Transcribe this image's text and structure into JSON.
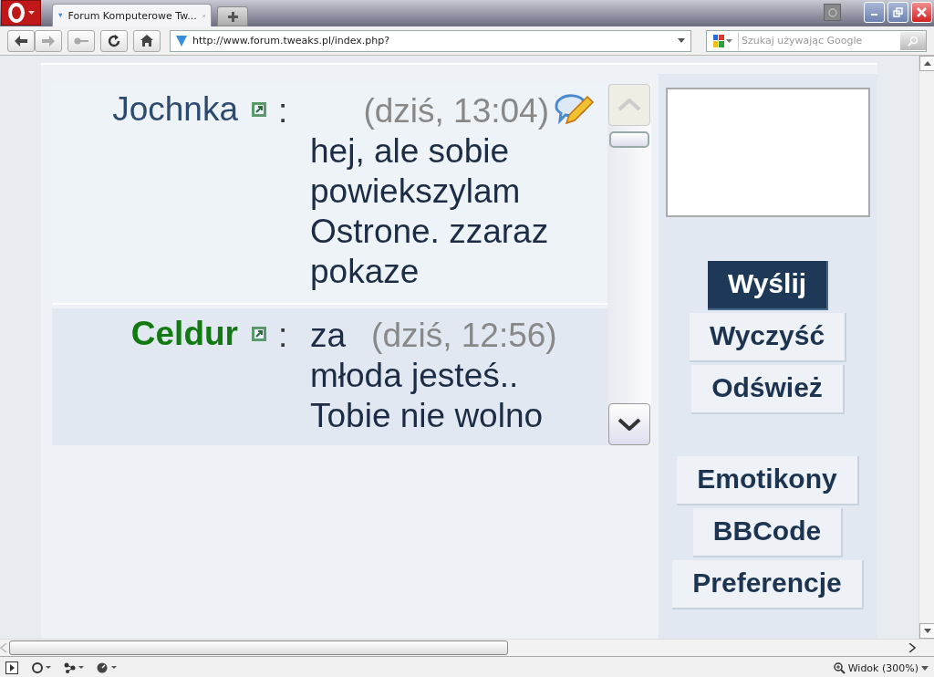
{
  "browser": {
    "tabs": [
      {
        "title": "Forum Komputerowe Tw...",
        "selected": true
      }
    ],
    "address": "http://www.forum.tweaks.pl/index.php?",
    "search": {
      "placeholder": "Szukaj używając Google"
    },
    "zoom": "Widok (300%)"
  },
  "chat": {
    "messages": [
      {
        "author": "Jochnka",
        "kind": "user",
        "color": "#2c4a6e",
        "separator": ":",
        "time": "(dziś, 13:04)",
        "editable": true,
        "text": "hej, ale sobie powiekszylam Ostrone. zzaraz pokaze"
      },
      {
        "author": "Celdur",
        "kind": "moderator",
        "color": "#137a13",
        "separator": ":",
        "lead": "za",
        "time": "(dziś, 12:56)",
        "editable": false,
        "text": "młoda jesteś.. Tobie nie wolno"
      }
    ]
  },
  "sidebar": {
    "send_buttons": [
      "Wyślij",
      "Wyczyść",
      "Odśwież"
    ],
    "tool_buttons": [
      "Emotikony",
      "BBCode",
      "Preferencje"
    ]
  }
}
